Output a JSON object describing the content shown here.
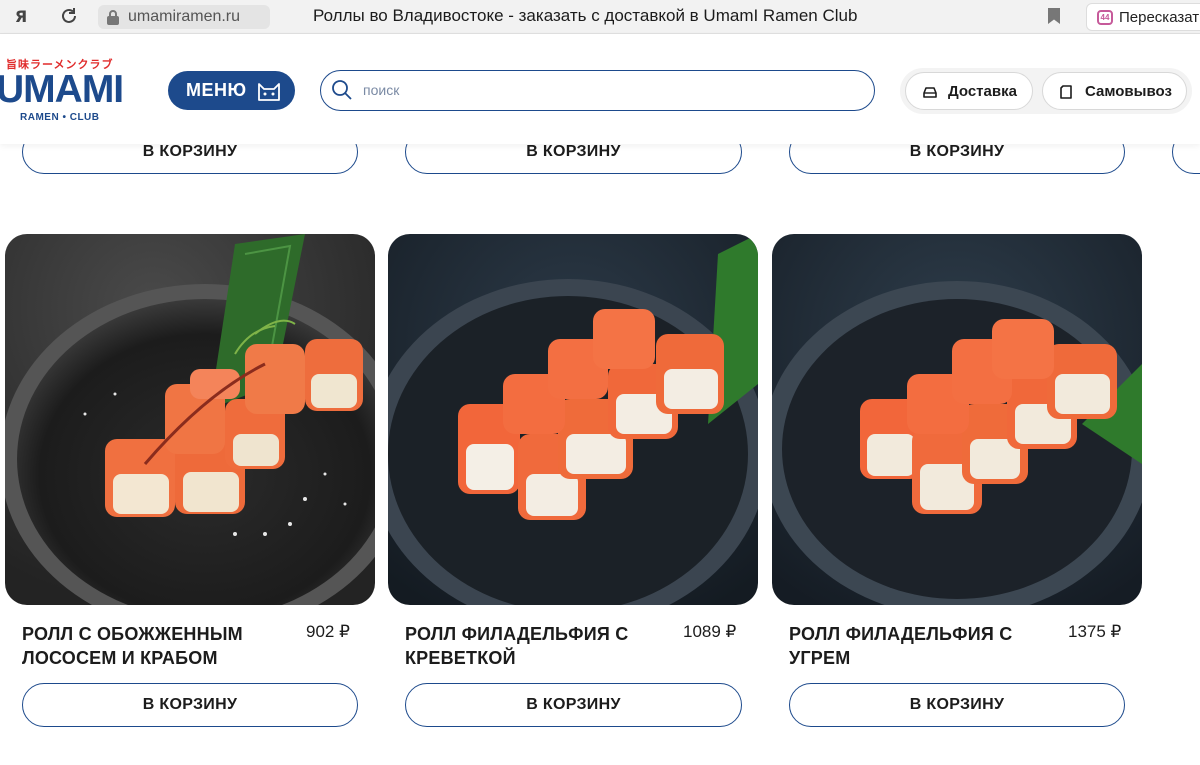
{
  "browser": {
    "url": "umamiramen.ru",
    "tab_title": "Роллы во Владивостоке - заказать с доставкой в UmamI Ramen Club",
    "translate_label": "Пересказать",
    "translate_badge": "44"
  },
  "header": {
    "logo_jp": "旨味ラーメンクラブ",
    "logo_main": "UMAMI",
    "logo_sub": "RAMEN • CLUB",
    "menu_label": "МЕНЮ",
    "search_placeholder": "поиск",
    "delivery_label": "Доставка",
    "pickup_label": "Самовывоз"
  },
  "top_row": {
    "cart_label": "В КОРЗИНУ"
  },
  "products": [
    {
      "name": "РОЛЛ С ОБОЖЖЕННЫМ ЛОСОСЕМ И КРАБОМ",
      "price": "902 ₽",
      "cart_label": "В КОРЗИНУ"
    },
    {
      "name": "РОЛЛ ФИЛАДЕЛЬФИЯ С КРЕВЕТКОЙ",
      "price": "1089 ₽",
      "cart_label": "В КОРЗИНУ"
    },
    {
      "name": "РОЛЛ ФИЛАДЕЛЬФИЯ С УГРЕМ",
      "price": "1375 ₽",
      "cart_label": "В КОРЗИНУ"
    }
  ],
  "colors": {
    "brand_blue": "#1d4a8c",
    "accent_red": "#e02b2b",
    "salmon": "#f06a35"
  }
}
